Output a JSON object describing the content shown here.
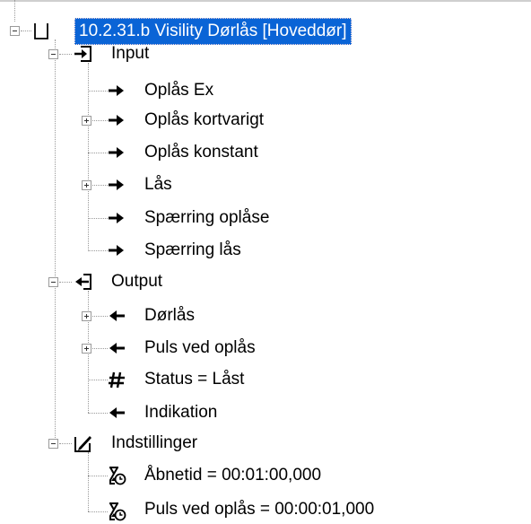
{
  "root": {
    "label": "10.2.31.b Visility Dørlås [Hoveddør]",
    "expanded": true,
    "icon": "device-box-icon"
  },
  "groups": [
    {
      "label": "Input",
      "icon": "input-icon",
      "expanded": true,
      "children": [
        {
          "label": "Oplås Ex",
          "icon": "arrow-right-icon",
          "expandable": false
        },
        {
          "label": "Oplås kortvarigt",
          "icon": "arrow-right-icon",
          "expandable": true
        },
        {
          "label": "Oplås konstant",
          "icon": "arrow-right-icon",
          "expandable": false
        },
        {
          "label": "Lås",
          "icon": "arrow-right-icon",
          "expandable": true
        },
        {
          "label": "Spærring oplåse",
          "icon": "arrow-right-icon",
          "expandable": false
        },
        {
          "label": "Spærring lås",
          "icon": "arrow-right-icon",
          "expandable": false
        }
      ]
    },
    {
      "label": "Output",
      "icon": "output-icon",
      "expanded": true,
      "children": [
        {
          "label": "Dørlås",
          "icon": "arrow-left-icon",
          "expandable": true
        },
        {
          "label": "Puls ved oplås",
          "icon": "arrow-left-icon",
          "expandable": true
        },
        {
          "label": "Status = Låst",
          "icon": "hash-icon",
          "expandable": false
        },
        {
          "label": "Indikation",
          "icon": "arrow-left-icon",
          "expandable": false
        }
      ]
    },
    {
      "label": "Indstillinger",
      "icon": "settings-icon",
      "expanded": true,
      "children": [
        {
          "label": "Åbnetid = 00:01:00,000",
          "icon": "timer-icon",
          "expandable": false
        },
        {
          "label": "Puls ved oplås = 00:00:01,000",
          "icon": "timer-icon",
          "expandable": false
        }
      ]
    }
  ],
  "colors": {
    "selection": "#0a64d6",
    "treeLines": "#9a9a9a"
  }
}
